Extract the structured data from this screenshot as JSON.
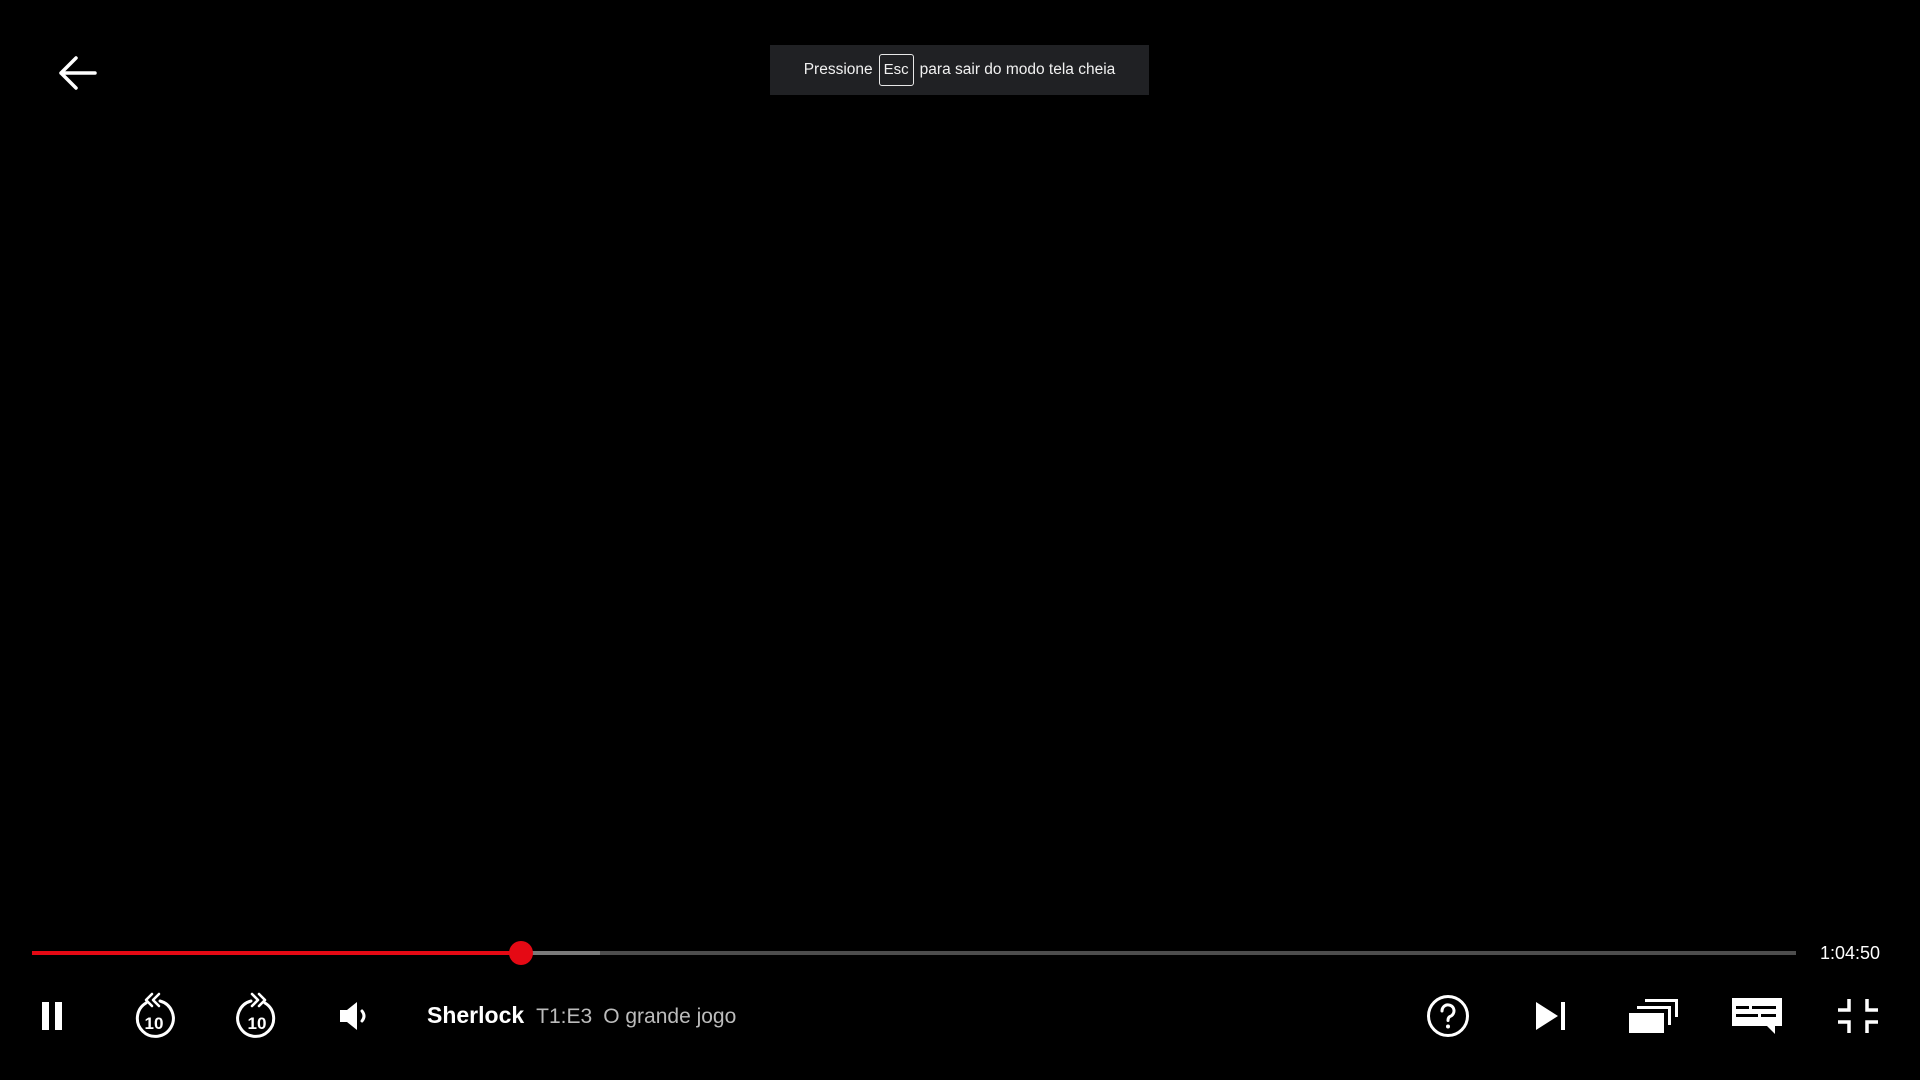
{
  "fullscreen_notice": {
    "before": "Pressione",
    "key": "Esc",
    "after": "para sair do modo tela cheia"
  },
  "player": {
    "progress": 0.277,
    "buffered": 0.322,
    "time_remaining": "1:04:50",
    "accent_color": "#e50914"
  },
  "now_playing": {
    "show": "Sherlock",
    "episode": "T1:E3",
    "episode_title": "O grande jogo"
  },
  "controls": {
    "left": [
      "play-pause",
      "rewind-10",
      "forward-10",
      "volume"
    ],
    "right": [
      "help",
      "next-episode",
      "episodes",
      "subtitles-audio",
      "exit-fullscreen"
    ],
    "skip_seconds_label": "10"
  }
}
